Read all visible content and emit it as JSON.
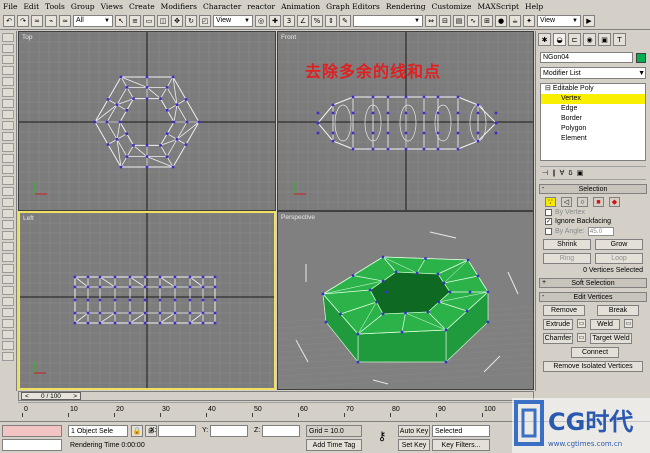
{
  "menu": [
    "File",
    "Edit",
    "Tools",
    "Group",
    "Views",
    "Create",
    "Modifiers",
    "Character",
    "reactor",
    "Animation",
    "Graph Editors",
    "Rendering",
    "Customize",
    "MAXScript",
    "Help"
  ],
  "toolbar": {
    "filter_select": "All",
    "refcoord_select": "View",
    "named_sel_select": "",
    "right_view_select": "View"
  },
  "viewports": {
    "top": "Top",
    "front": "Front",
    "left": "Left",
    "perspective": "Perspective"
  },
  "overlay_text": "去除多余的线和点",
  "command_panel": {
    "object_name": "NGon04",
    "object_color": "#00b050",
    "modifier_list": "Modifier List",
    "stack": {
      "base": "Editable Poly",
      "subobjects": [
        "Vertex",
        "Edge",
        "Border",
        "Polygon",
        "Element"
      ],
      "selected": "Vertex"
    },
    "selection": {
      "title": "Selection",
      "by_vertex": "By Vertex",
      "ignore_backfacing": "Ignore Backfacing",
      "by_angle": "By Angle:",
      "angle_value": "45.0",
      "shrink": "Shrink",
      "grow": "Grow",
      "ring": "Ring",
      "loop": "Loop",
      "status": "0 Vertices Selected"
    },
    "soft_selection": "Soft Selection",
    "edit_vertices": {
      "title": "Edit Vertices",
      "remove": "Remove",
      "break": "Break",
      "extrude": "Extrude",
      "weld": "Weld",
      "chamfer": "Chamfer",
      "target_weld": "Target Weld",
      "connect": "Connect",
      "remove_isolated": "Remove Isolated Vertices"
    }
  },
  "timeline": {
    "slider": "0 / 100",
    "ticks": [
      "0",
      "10",
      "20",
      "30",
      "40",
      "50",
      "60",
      "70",
      "80",
      "90",
      "100"
    ]
  },
  "status": {
    "object_selected": "1 Object Sele",
    "x_label": "X:",
    "y_label": "Y:",
    "z_label": "Z:",
    "grid": "Grid = 10.0",
    "rendering_time": "Rendering Time  0:00:00",
    "add_time_tag": "Add Time Tag",
    "auto_key": "Auto Key",
    "auto_key_select": "Selected",
    "set_key": "Set Key",
    "key_filters": "Key Filters..."
  },
  "logo": {
    "brand": "CG时代",
    "url": "www.cgtimes.com.cn"
  },
  "colors": {
    "viewport_bg": "#7c7c7c",
    "active_border": "#f0e060",
    "vertex": "#3a30c8",
    "mesh_green": "#2bb34a",
    "overlay_red": "#e02020"
  }
}
